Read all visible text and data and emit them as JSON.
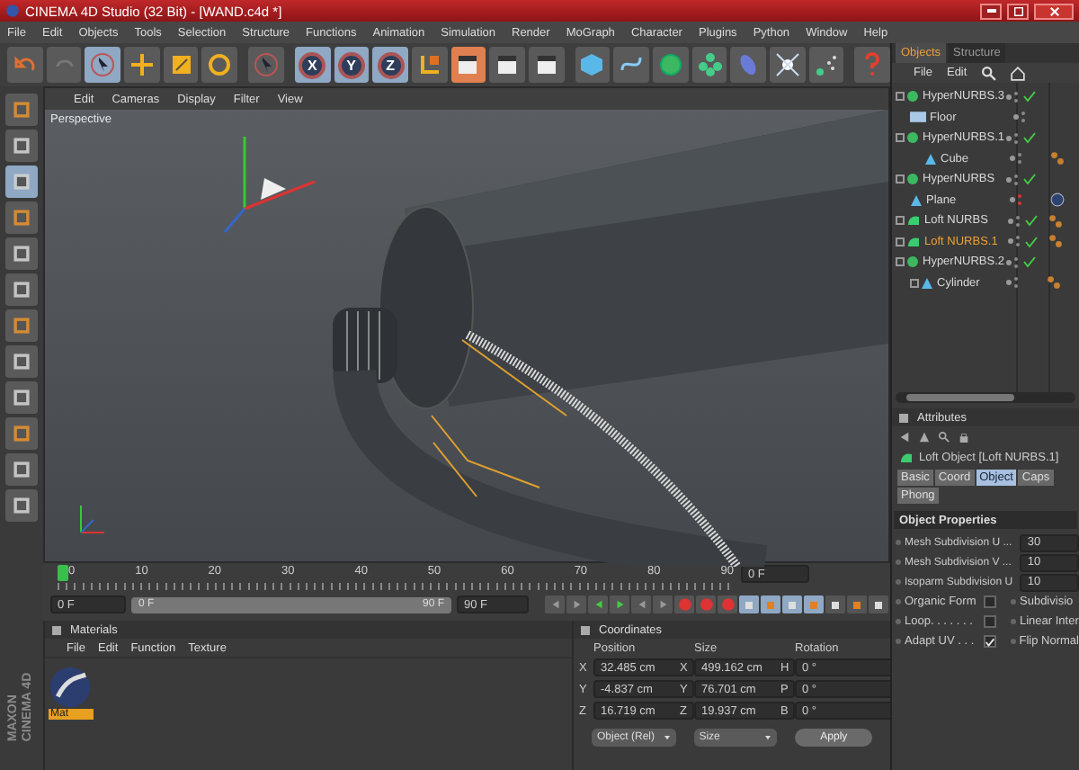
{
  "window": {
    "title": "CINEMA 4D Studio (32 Bit) - [WAND.c4d *]"
  },
  "menu": [
    "File",
    "Edit",
    "Objects",
    "Tools",
    "Selection",
    "Structure",
    "Functions",
    "Animation",
    "Simulation",
    "Render",
    "MoGraph",
    "Character",
    "Plugins",
    "Python",
    "Window",
    "Help"
  ],
  "toolbar": {
    "axes": [
      "X",
      "Y",
      "Z"
    ]
  },
  "viewport": {
    "menu": [
      "Edit",
      "Cameras",
      "Display",
      "Filter",
      "View"
    ],
    "camera": "Perspective"
  },
  "timeline": {
    "ticks": [
      "0",
      "10",
      "20",
      "30",
      "40",
      "50",
      "60",
      "70",
      "80",
      "90"
    ],
    "start": "0 F",
    "range": {
      "start": "0 F",
      "end": "90 F",
      "level": 1
    },
    "end": "90 F",
    "current": "0 F",
    "level": 0
  },
  "materials": {
    "title": "Materials",
    "menu": [
      "File",
      "Edit",
      "Function",
      "Texture"
    ],
    "items": [
      {
        "name": "Mat",
        "selected": true
      }
    ]
  },
  "coordinates": {
    "title": "Coordinates",
    "headings": [
      "Position",
      "Size",
      "Rotation"
    ],
    "rows": [
      {
        "axis": "X",
        "position": "32.485 cm",
        "size_axis": "X",
        "size": "499.162 cm",
        "rot_axis": "H",
        "rotation": "0 °"
      },
      {
        "axis": "Y",
        "position": "-4.837 cm",
        "size_axis": "Y",
        "size": "76.701 cm",
        "rot_axis": "P",
        "rotation": "0 °"
      },
      {
        "axis": "Z",
        "position": "16.719 cm",
        "size_axis": "Z",
        "size": "19.937 cm",
        "rot_axis": "B",
        "rotation": "0 °"
      }
    ],
    "mode": "Object (Rel)",
    "size_mode": "Size",
    "apply": "Apply"
  },
  "objects": {
    "tabs": [
      {
        "label": "Objects",
        "selected": true
      },
      {
        "label": "Structure",
        "selected": false
      }
    ],
    "menu": [
      "File",
      "Edit"
    ],
    "tree": [
      {
        "name": "HyperNURBS.3",
        "kind": "hypernurbs",
        "expandable": true,
        "selected": false,
        "checked": true,
        "hidden": false
      },
      {
        "name": "Floor",
        "kind": "floor",
        "expandable": false,
        "selected": false,
        "checked": false,
        "hidden": false
      },
      {
        "name": "HyperNURBS.1",
        "kind": "hypernurbs",
        "expandable": true,
        "selected": false,
        "checked": true,
        "hidden": false,
        "children": [
          {
            "name": "Cube",
            "kind": "primitive",
            "expandable": false,
            "selected": false,
            "checked": false,
            "hidden": false,
            "tags": [
              {
                "kind": "phong"
              }
            ]
          }
        ]
      },
      {
        "name": "HyperNURBS",
        "kind": "hypernurbs",
        "expandable": true,
        "selected": false,
        "checked": true,
        "hidden": false
      },
      {
        "name": "Plane",
        "kind": "primitive",
        "expandable": false,
        "selected": false,
        "checked": false,
        "hidden": true,
        "tags": [
          {
            "kind": "material"
          }
        ]
      },
      {
        "name": "Loft NURBS",
        "kind": "loft",
        "expandable": true,
        "selected": false,
        "checked": true,
        "hidden": false,
        "tags": [
          {
            "kind": "phong"
          }
        ]
      },
      {
        "name": "Loft NURBS.1",
        "kind": "loft",
        "expandable": true,
        "selected": true,
        "checked": true,
        "hidden": false,
        "tags": [
          {
            "kind": "phong"
          }
        ]
      },
      {
        "name": "HyperNURBS.2",
        "kind": "hypernurbs",
        "expandable": true,
        "selected": false,
        "checked": true,
        "hidden": false,
        "children": [
          {
            "name": "Cylinder",
            "kind": "primitive",
            "expandable": true,
            "selected": false,
            "checked": false,
            "hidden": false,
            "tags": [
              {
                "kind": "phong"
              }
            ]
          }
        ]
      }
    ]
  },
  "attributes": {
    "title": "Attributes",
    "object": "Loft Object [Loft NURBS.1]",
    "tabs": [
      {
        "label": "Basic",
        "selected": false
      },
      {
        "label": "Coord",
        "selected": false
      },
      {
        "label": "Object",
        "selected": true
      },
      {
        "label": "Caps",
        "selected": false
      },
      {
        "label": "Phong",
        "selected": false
      }
    ],
    "section": "Object Properties",
    "fields": [
      {
        "label": "Mesh Subdivision U ...",
        "value": "30"
      },
      {
        "label": "Mesh Subdivision V ...",
        "value": "10"
      },
      {
        "label": "Isoparm Subdivision U",
        "value": "10"
      }
    ],
    "options": [
      {
        "label": "Organic Form",
        "checked": false,
        "side": "Subdivisio"
      },
      {
        "label": "Loop. . . . . . .",
        "checked": false,
        "side": "Linear Inter"
      },
      {
        "label": "Adapt UV . . .",
        "checked": true,
        "side": "Flip Normal"
      }
    ]
  },
  "logo": [
    "MAXON",
    "CINEMA 4D"
  ]
}
